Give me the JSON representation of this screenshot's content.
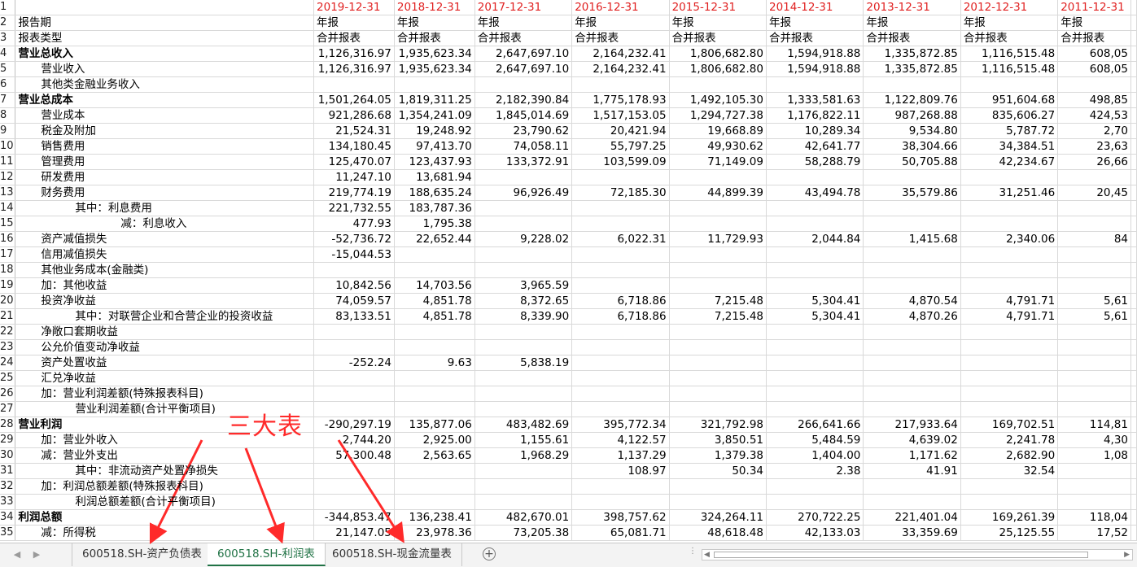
{
  "columns": [
    "2019-12-31",
    "2018-12-31",
    "2017-12-31",
    "2016-12-31",
    "2015-12-31",
    "2014-12-31",
    "2013-12-31",
    "2012-12-31",
    "2011-12-31"
  ],
  "header_rows": [
    {
      "num": "1",
      "label": "",
      "values": [
        "2019-12-31",
        "2018-12-31",
        "2017-12-31",
        "2016-12-31",
        "2015-12-31",
        "2014-12-31",
        "2013-12-31",
        "2012-12-31",
        "2011-12-31"
      ]
    },
    {
      "num": "2",
      "label": "报告期",
      "values": [
        "年报",
        "年报",
        "年报",
        "年报",
        "年报",
        "年报",
        "年报",
        "年报",
        "年报"
      ]
    },
    {
      "num": "3",
      "label": "报表类型",
      "values": [
        "合并报表",
        "合并报表",
        "合并报表",
        "合并报表",
        "合并报表",
        "合并报表",
        "合并报表",
        "合并报表",
        "合并报表"
      ]
    }
  ],
  "rows": [
    {
      "num": "4",
      "label": "营业总收入",
      "bold": true,
      "indent": 0,
      "values": [
        "1,126,316.97",
        "1,935,623.34",
        "2,647,697.10",
        "2,164,232.41",
        "1,806,682.80",
        "1,594,918.88",
        "1,335,872.85",
        "1,116,515.48",
        "608,05"
      ]
    },
    {
      "num": "5",
      "label": "营业收入",
      "bold": false,
      "indent": 2,
      "values": [
        "1,126,316.97",
        "1,935,623.34",
        "2,647,697.10",
        "2,164,232.41",
        "1,806,682.80",
        "1,594,918.88",
        "1,335,872.85",
        "1,116,515.48",
        "608,05"
      ]
    },
    {
      "num": "6",
      "label": "其他类金融业务收入",
      "bold": false,
      "indent": 2,
      "values": [
        "",
        "",
        "",
        "",
        "",
        "",
        "",
        "",
        ""
      ]
    },
    {
      "num": "7",
      "label": "营业总成本",
      "bold": true,
      "indent": 0,
      "values": [
        "1,501,264.05",
        "1,819,311.25",
        "2,182,390.84",
        "1,775,178.93",
        "1,492,105.30",
        "1,333,581.63",
        "1,122,809.76",
        "951,604.68",
        "498,85"
      ]
    },
    {
      "num": "8",
      "label": "营业成本",
      "bold": false,
      "indent": 2,
      "values": [
        "921,286.68",
        "1,354,241.09",
        "1,845,014.69",
        "1,517,153.05",
        "1,294,727.38",
        "1,176,822.11",
        "987,268.88",
        "835,606.27",
        "424,53"
      ]
    },
    {
      "num": "9",
      "label": "税金及附加",
      "bold": false,
      "indent": 2,
      "values": [
        "21,524.31",
        "19,248.92",
        "23,790.62",
        "20,421.94",
        "19,668.89",
        "10,289.34",
        "9,534.80",
        "5,787.72",
        "2,70"
      ]
    },
    {
      "num": "10",
      "label": "销售费用",
      "bold": false,
      "indent": 2,
      "values": [
        "134,180.45",
        "97,413.70",
        "74,058.11",
        "55,797.25",
        "49,930.62",
        "42,641.77",
        "38,304.66",
        "34,384.51",
        "23,63"
      ]
    },
    {
      "num": "11",
      "label": "管理费用",
      "bold": false,
      "indent": 2,
      "values": [
        "125,470.07",
        "123,437.93",
        "133,372.91",
        "103,599.09",
        "71,149.09",
        "58,288.79",
        "50,705.88",
        "42,234.67",
        "26,66"
      ]
    },
    {
      "num": "12",
      "label": "研发费用",
      "bold": false,
      "indent": 2,
      "values": [
        "11,247.10",
        "13,681.94",
        "",
        "",
        "",
        "",
        "",
        "",
        ""
      ]
    },
    {
      "num": "13",
      "label": "财务费用",
      "bold": false,
      "indent": 2,
      "values": [
        "219,774.19",
        "188,635.24",
        "96,926.49",
        "72,185.30",
        "44,899.39",
        "43,494.78",
        "35,579.86",
        "31,251.46",
        "20,45"
      ]
    },
    {
      "num": "14",
      "label": "其中：利息费用",
      "bold": false,
      "indent": 5,
      "values": [
        "221,732.55",
        "183,787.36",
        "",
        "",
        "",
        "",
        "",
        "",
        ""
      ]
    },
    {
      "num": "15",
      "label": "减：利息收入",
      "bold": false,
      "indent": 9,
      "values": [
        "477.93",
        "1,795.38",
        "",
        "",
        "",
        "",
        "",
        "",
        ""
      ]
    },
    {
      "num": "16",
      "label": "资产减值损失",
      "bold": false,
      "indent": 2,
      "values": [
        "-52,736.72",
        "22,652.44",
        "9,228.02",
        "6,022.31",
        "11,729.93",
        "2,044.84",
        "1,415.68",
        "2,340.06",
        "84"
      ]
    },
    {
      "num": "17",
      "label": "信用减值损失",
      "bold": false,
      "indent": 2,
      "values": [
        "-15,044.53",
        "",
        "",
        "",
        "",
        "",
        "",
        "",
        ""
      ]
    },
    {
      "num": "18",
      "label": "其他业务成本(金融类)",
      "bold": false,
      "indent": 2,
      "values": [
        "",
        "",
        "",
        "",
        "",
        "",
        "",
        "",
        ""
      ]
    },
    {
      "num": "19",
      "label": "加：其他收益",
      "bold": false,
      "indent": 2,
      "values": [
        "10,842.56",
        "14,703.56",
        "3,965.59",
        "",
        "",
        "",
        "",
        "",
        ""
      ]
    },
    {
      "num": "20",
      "label": "投资净收益",
      "bold": false,
      "indent": 2,
      "values": [
        "74,059.57",
        "4,851.78",
        "8,372.65",
        "6,718.86",
        "7,215.48",
        "5,304.41",
        "4,870.54",
        "4,791.71",
        "5,61"
      ]
    },
    {
      "num": "21",
      "label": "其中：对联营企业和合营企业的投资收益",
      "bold": false,
      "indent": 5,
      "values": [
        "83,133.51",
        "4,851.78",
        "8,339.90",
        "6,718.86",
        "7,215.48",
        "5,304.41",
        "4,870.26",
        "4,791.71",
        "5,61"
      ]
    },
    {
      "num": "22",
      "label": "净敞口套期收益",
      "bold": false,
      "indent": 2,
      "values": [
        "",
        "",
        "",
        "",
        "",
        "",
        "",
        "",
        ""
      ]
    },
    {
      "num": "23",
      "label": "公允价值变动净收益",
      "bold": false,
      "indent": 2,
      "values": [
        "",
        "",
        "",
        "",
        "",
        "",
        "",
        "",
        ""
      ]
    },
    {
      "num": "24",
      "label": "资产处置收益",
      "bold": false,
      "indent": 2,
      "values": [
        "-252.24",
        "9.63",
        "5,838.19",
        "",
        "",
        "",
        "",
        "",
        ""
      ]
    },
    {
      "num": "25",
      "label": "汇兑净收益",
      "bold": false,
      "indent": 2,
      "values": [
        "",
        "",
        "",
        "",
        "",
        "",
        "",
        "",
        ""
      ]
    },
    {
      "num": "26",
      "label": "加：营业利润差额(特殊报表科目)",
      "bold": false,
      "indent": 2,
      "values": [
        "",
        "",
        "",
        "",
        "",
        "",
        "",
        "",
        ""
      ]
    },
    {
      "num": "27",
      "label": "营业利润差额(合计平衡项目)",
      "bold": false,
      "indent": 5,
      "values": [
        "",
        "",
        "",
        "",
        "",
        "",
        "",
        "",
        ""
      ]
    },
    {
      "num": "28",
      "label": "营业利润",
      "bold": true,
      "indent": 0,
      "values": [
        "-290,297.19",
        "135,877.06",
        "483,482.69",
        "395,772.34",
        "321,792.98",
        "266,641.66",
        "217,933.64",
        "169,702.51",
        "114,81"
      ]
    },
    {
      "num": "29",
      "label": "加：营业外收入",
      "bold": false,
      "indent": 2,
      "values": [
        "2,744.20",
        "2,925.00",
        "1,155.61",
        "4,122.57",
        "3,850.51",
        "5,484.59",
        "4,639.02",
        "2,241.78",
        "4,30"
      ]
    },
    {
      "num": "30",
      "label": "减：营业外支出",
      "bold": false,
      "indent": 2,
      "values": [
        "57,300.48",
        "2,563.65",
        "1,968.29",
        "1,137.29",
        "1,379.38",
        "1,404.00",
        "1,171.62",
        "2,682.90",
        "1,08"
      ]
    },
    {
      "num": "31",
      "label": "其中：非流动资产处置净损失",
      "bold": false,
      "indent": 5,
      "values": [
        "",
        "",
        "",
        "108.97",
        "50.34",
        "2.38",
        "41.91",
        "32.54",
        ""
      ]
    },
    {
      "num": "32",
      "label": "加：利润总额差额(特殊报表科目)",
      "bold": false,
      "indent": 2,
      "values": [
        "",
        "",
        "",
        "",
        "",
        "",
        "",
        "",
        ""
      ]
    },
    {
      "num": "33",
      "label": "利润总额差额(合计平衡项目)",
      "bold": false,
      "indent": 5,
      "values": [
        "",
        "",
        "",
        "",
        "",
        "",
        "",
        "",
        ""
      ]
    },
    {
      "num": "34",
      "label": "利润总额",
      "bold": true,
      "indent": 0,
      "values": [
        "-344,853.47",
        "136,238.41",
        "482,670.01",
        "398,757.62",
        "324,264.11",
        "270,722.25",
        "221,401.04",
        "169,261.39",
        "118,04"
      ]
    },
    {
      "num": "35",
      "label": "减：所得税",
      "bold": false,
      "indent": 2,
      "values": [
        "21,147.05",
        "23,978.36",
        "73,205.38",
        "65,081.71",
        "48,618.48",
        "42,133.03",
        "33,359.69",
        "25,125.55",
        "17,52"
      ]
    }
  ],
  "sheet_tabs": [
    {
      "label": "600518.SH-资产负债表",
      "active": false
    },
    {
      "label": "600518.SH-利润表",
      "active": true
    },
    {
      "label": "600518.SH-现金流量表",
      "active": false
    }
  ],
  "annotation": {
    "text": "三大表",
    "color": "#ff2a2a"
  },
  "colors": {
    "date_header": "#e02020",
    "active_tab": "#217346",
    "annotation": "#ff2a2a"
  }
}
